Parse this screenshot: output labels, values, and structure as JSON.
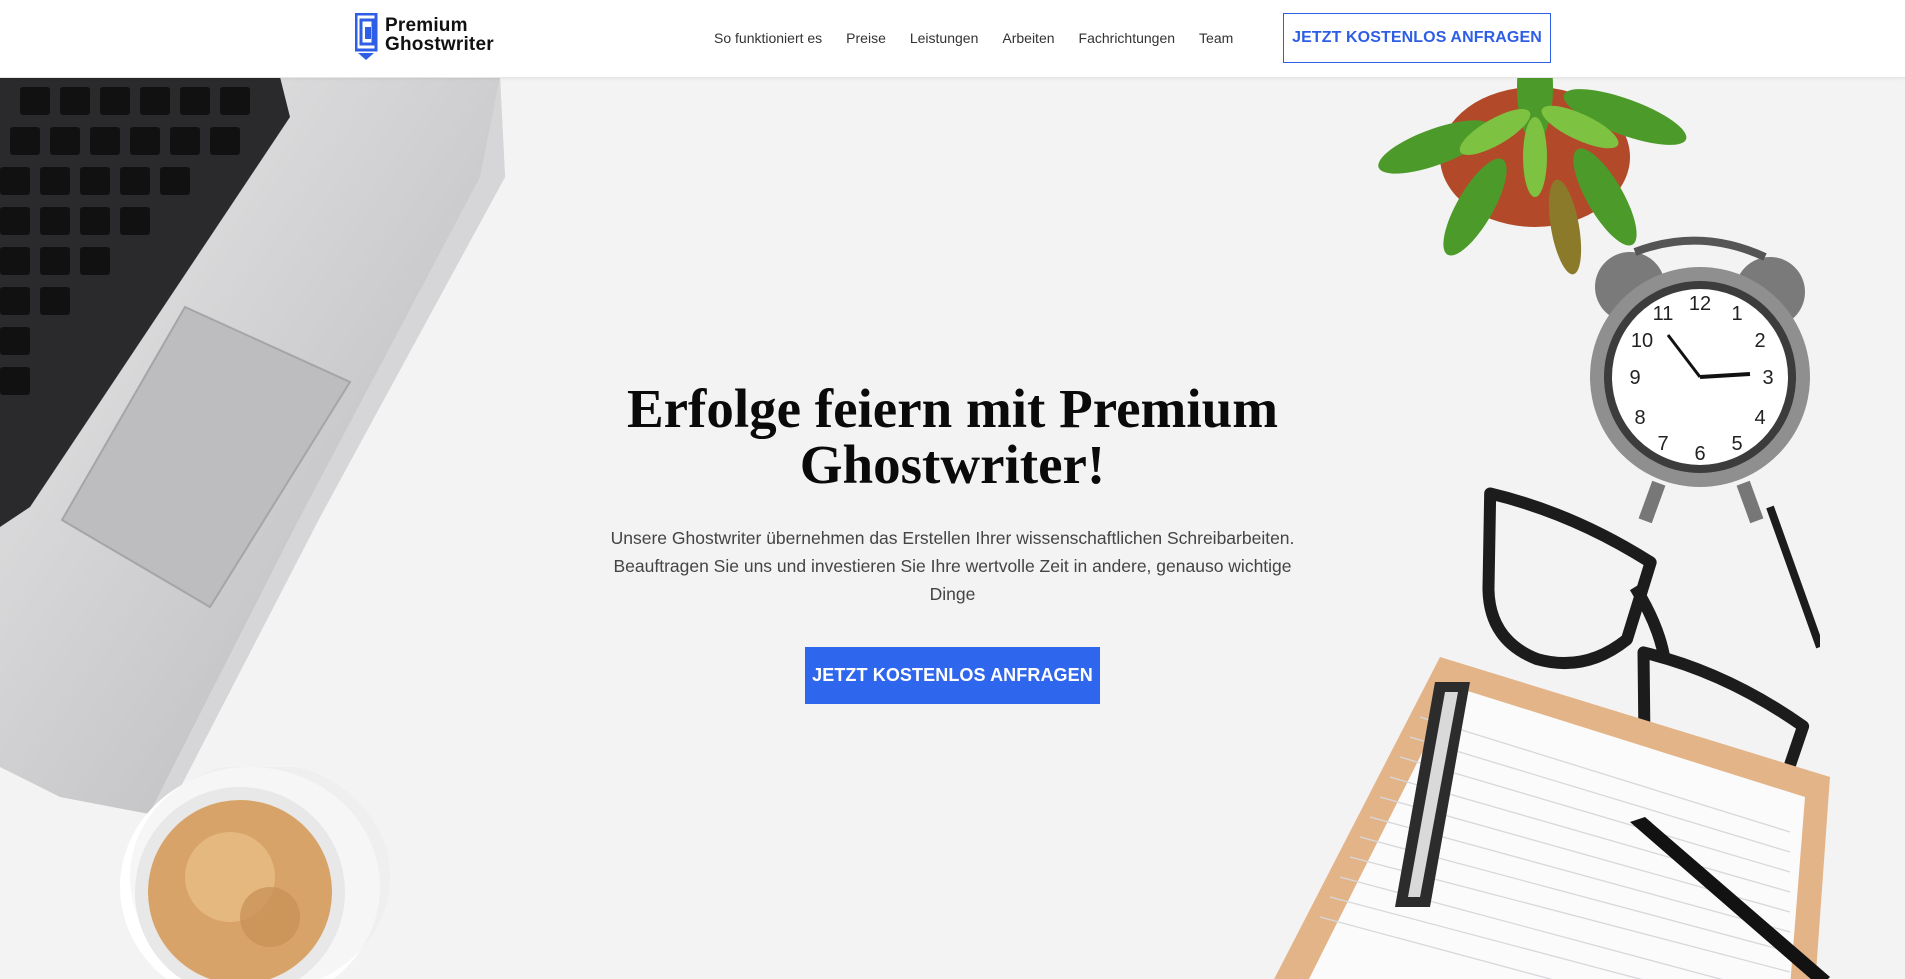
{
  "brand": {
    "line1": "Premium",
    "line2": "Ghostwriter",
    "color": "#2f5ee6"
  },
  "nav": {
    "links": [
      "So funktioniert es",
      "Preise",
      "Leistungen",
      "Arbeiten",
      "Fachrichtungen",
      "Team"
    ],
    "cta_label": "JETZT KOSTENLOS ANFRAGEN"
  },
  "hero": {
    "headline": "Erfolge feiern mit Premium Ghostwriter!",
    "subtext": "Unsere Ghostwriter übernehmen das Erstellen Ihrer wissenschaftlichen Schreibarbeiten. Beauftragen Sie uns und investieren Sie Ihre wertvolle Zeit in andere, genauso wichtige Dinge",
    "cta_label": "JETZT KOSTENLOS ANFRAGEN",
    "accent_color": "#2f66ee"
  },
  "decor": [
    "laptop",
    "coffee-cup",
    "succulent-plant",
    "alarm-clock",
    "glasses",
    "clipboard",
    "pen"
  ]
}
